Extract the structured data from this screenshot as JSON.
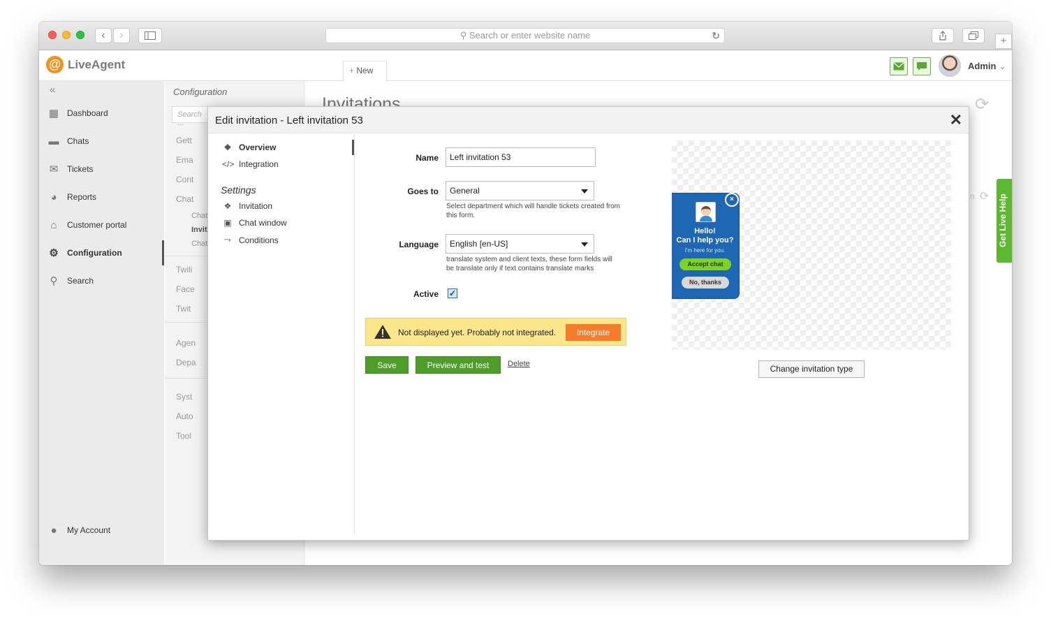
{
  "browser": {
    "url_placeholder": "Search or enter website name",
    "back": "‹",
    "forward": "›",
    "add_tab": "+"
  },
  "colors": {
    "accent": "#f29018",
    "green": "#4e9d28",
    "warning": "#fbe68b",
    "integrate": "#f47c2a",
    "invitation": "#1e67b5"
  },
  "header": {
    "logo_mark": "@",
    "logo": "LiveAgent",
    "new_tab": "New",
    "user": "Admin",
    "icons": [
      "mail-icon",
      "chat-bubble-icon"
    ]
  },
  "sidebar": {
    "items": [
      {
        "label": "Dashboard",
        "icon": "dashboard-icon"
      },
      {
        "label": "Chats",
        "icon": "chat-icon"
      },
      {
        "label": "Tickets",
        "icon": "envelope-icon"
      },
      {
        "label": "Reports",
        "icon": "pie-chart-icon"
      },
      {
        "label": "Customer portal",
        "icon": "bank-icon"
      },
      {
        "label": "Configuration",
        "icon": "gear-icon"
      },
      {
        "label": "Search",
        "icon": "magnifier-icon"
      }
    ],
    "account": "My Account"
  },
  "config_panel": {
    "title": "Configuration",
    "search_placeholder": "Search ...",
    "items": [
      "Gett",
      "Ema",
      "Cont",
      "Chat",
      "Twili",
      "Face",
      "Twit",
      "Agen",
      "Depa",
      "Syst",
      "Auto",
      "Tool"
    ],
    "sub_items": [
      "Chat",
      "Invit",
      "Chat"
    ]
  },
  "background": {
    "title": "Invitations",
    "partial_text": "n"
  },
  "livehelp": "Get Live Help",
  "modal": {
    "title": "Edit invitation - Left invitation 53",
    "close": "✕",
    "menu": {
      "overview": "Overview",
      "integration": "Integration",
      "settings_heading": "Settings",
      "invitation": "Invitation",
      "chat_window": "Chat window",
      "conditions": "Conditions"
    },
    "form": {
      "name_label": "Name",
      "name_value": "Left invitation 53",
      "goes_to_label": "Goes to",
      "goes_to_value": "General",
      "goes_to_hint": "Select department which will handle tickets created from this form.",
      "language_label": "Language",
      "language_value": "English [en-US]",
      "language_hint": "translate system and client texts, these form fields will be translate only if text contains translate marks",
      "active_label": "Active",
      "active_checked": true
    },
    "warning": {
      "text": "Not displayed yet. Probably not integrated.",
      "button": "Integrate"
    },
    "buttons": {
      "save": "Save",
      "preview": "Preview and test",
      "delete": "Delete"
    },
    "preview": {
      "close": "×",
      "hello": "Hello!",
      "help": "Can I help you?",
      "here": "I'm here for you.",
      "accept": "Accept chat",
      "decline": "No, thanks"
    },
    "change_type": "Change invitation type"
  }
}
